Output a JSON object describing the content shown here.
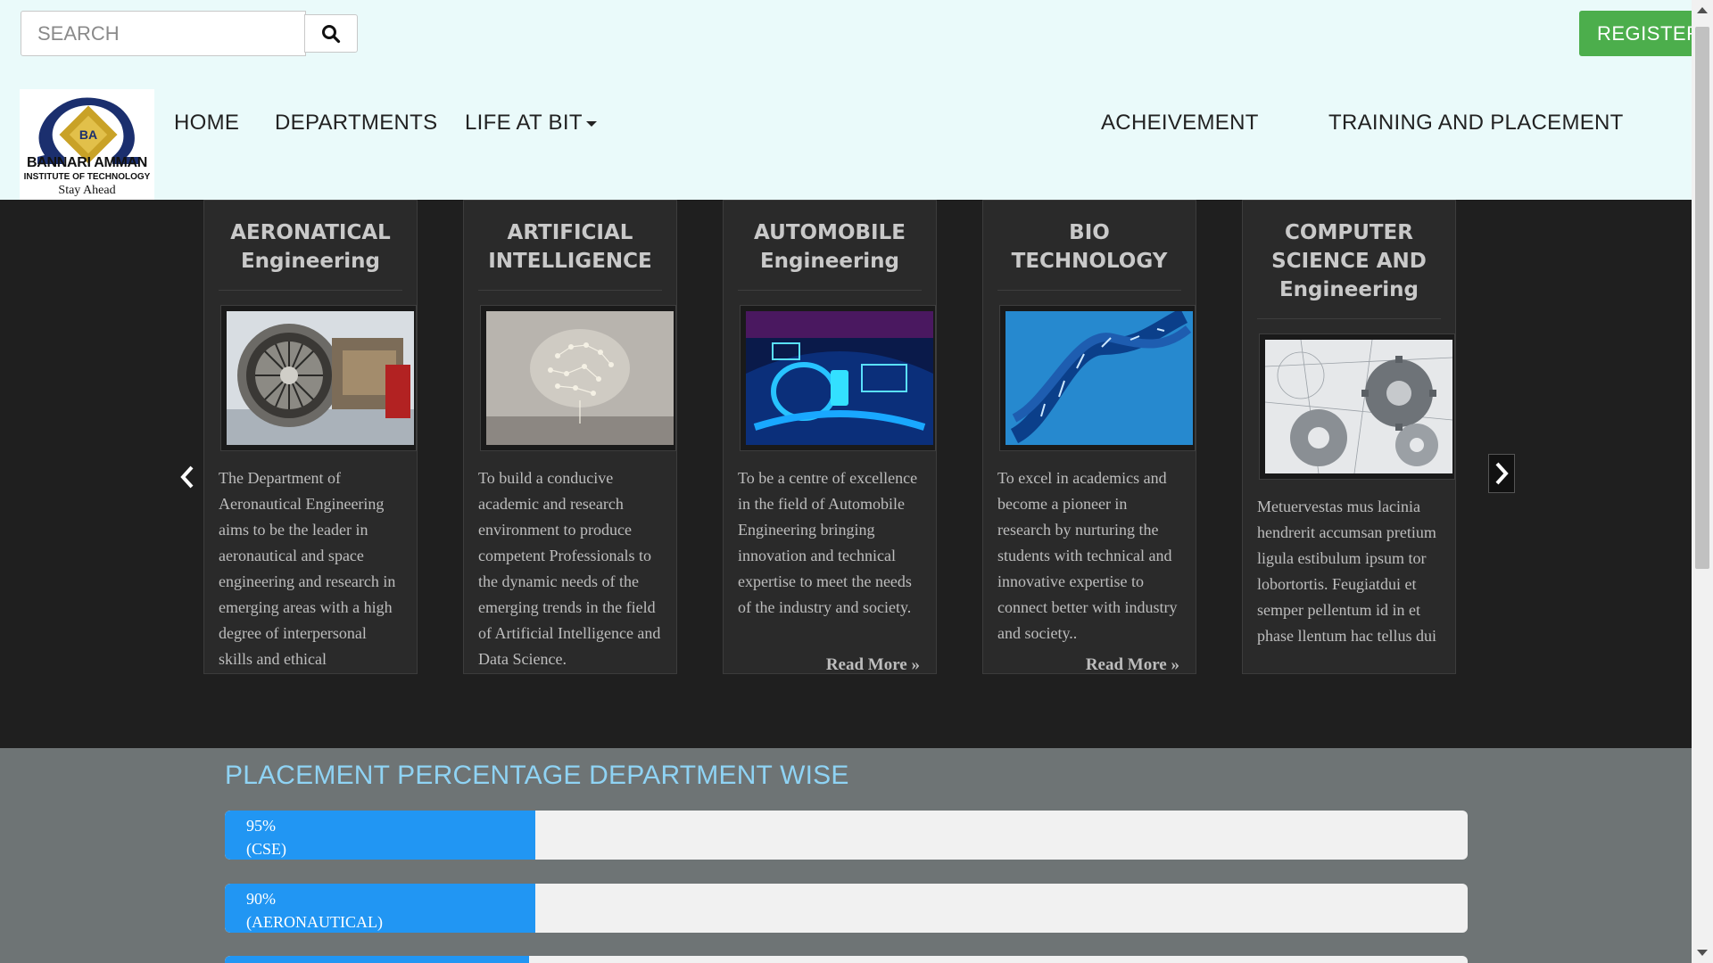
{
  "header": {
    "search_placeholder": "SEARCH",
    "search_icon": "search-icon",
    "register_label": "REGISTER",
    "logo": {
      "name": "BANNARI AMMAN",
      "subtitle": "INSTITUTE OF TECHNOLOGY",
      "tagline": "Stay Ahead"
    },
    "nav": {
      "home": "HOME",
      "departments": "DEPARTMENTS",
      "life_at_bit": "LIFE AT BIT",
      "achievement": "ACHEIVEMENT",
      "training": "TRAINING AND PLACEMENT"
    }
  },
  "departments": {
    "cards": [
      {
        "title_line1": "AERONATICAL",
        "title_line2": "Engineering",
        "title_line3": "",
        "image": "jet-engine-image",
        "text": "The Department of Aeronautical Engineering aims to be the leader in aeronautical and space engineering and research in emerging areas with a high degree of interpersonal skills and ethical responsibilities.",
        "read_more": ""
      },
      {
        "title_line1": "ARTIFICIAL",
        "title_line2": "INTELLIGENCE",
        "title_line3": "",
        "image": "circuit-brain-image",
        "text": "To build a conducive academic and research environment to produce competent Professionals to the dynamic needs of the emerging trends in the field of Artificial Intelligence and Data Science.",
        "read_more": ""
      },
      {
        "title_line1": "AUTOMOBILE",
        "title_line2": "Engineering",
        "title_line3": "",
        "image": "car-dashboard-image",
        "text": "To be a centre of excellence in the field of Automobile Engineering bringing innovation and technical expertise to meet the needs of the industry and society.",
        "read_more": "Read More »"
      },
      {
        "title_line1": "BIO",
        "title_line2": "TECHNOLOGY",
        "title_line3": "",
        "image": "dna-helix-image",
        "text": "To excel in academics and become a pioneer in research by nurturing the students with technical and innovative expertise to connect better with industry and society..",
        "read_more": "Read More »"
      },
      {
        "title_line1": "COMPUTER",
        "title_line2": "SCIENCE AND",
        "title_line3": "Engineering",
        "image": "gears-sketch-image",
        "text": "Metuervestas mus lacinia hendrerit accumsan pretium ligula estibulum ipsum tor lobortortis. Feugiatdui et semper pellentum id in et phase llentum hac tellus dui",
        "read_more": ""
      }
    ],
    "prev_icon": "chevron-left-icon",
    "next_icon": "chevron-right-icon"
  },
  "placement": {
    "title": "PLACEMENT PERCENTAGE DEPARTMENT WISE",
    "bars": [
      {
        "percent_label": "95%",
        "dept_label": "(CSE)",
        "fill_fraction": 0.25
      },
      {
        "percent_label": "90%",
        "dept_label": "(AERONAUTICAL)",
        "fill_fraction": 0.25
      },
      {
        "percent_label": "",
        "dept_label": "",
        "fill_fraction": 0.245
      }
    ]
  },
  "colors": {
    "header_bg": "#eafafa",
    "register_green": "#4cae4c",
    "carousel_bg": "#1f1f1f",
    "placement_bg": "#6e7475",
    "placement_title": "#8fd3f4",
    "bar_fill": "#2196f3"
  }
}
